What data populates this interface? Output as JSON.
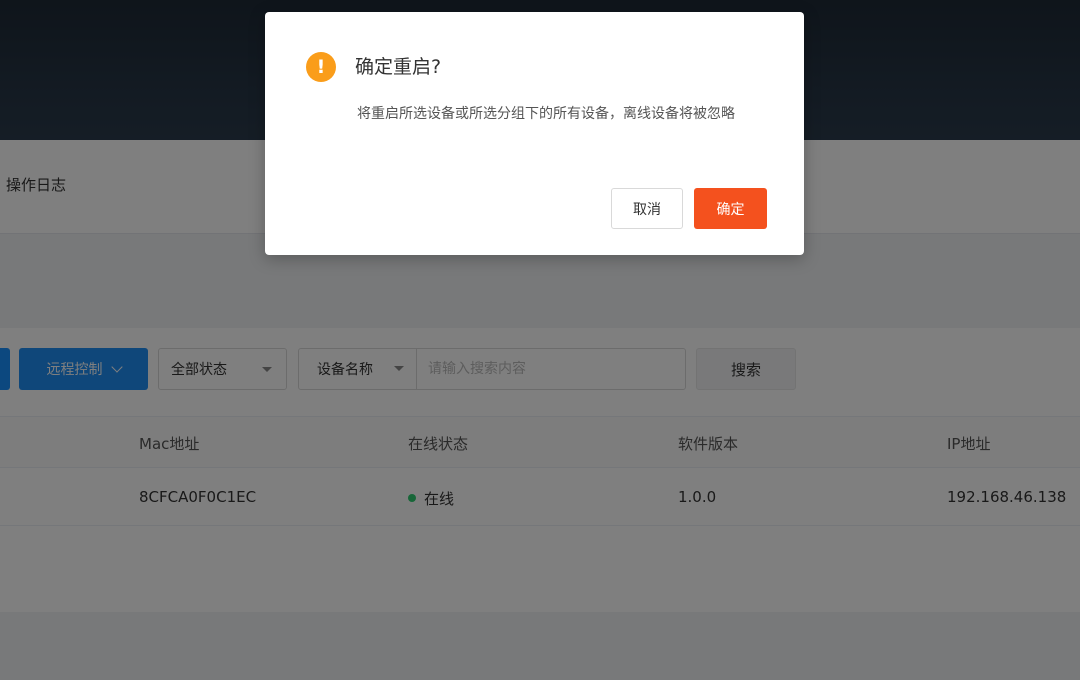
{
  "tabs": {
    "operation_log": "操作日志"
  },
  "toolbar": {
    "remote_control_label": "远程控制",
    "status_select_value": "全部状态",
    "field_select_value": "设备名称",
    "search_placeholder": "请输入搜索内容",
    "search_button_label": "搜索"
  },
  "table": {
    "columns": [
      "Mac地址",
      "在线状态",
      "软件版本",
      "IP地址"
    ],
    "rows": [
      {
        "mac": "8CFCA0F0C1EC",
        "status": "在线",
        "version": "1.0.0",
        "ip": "192.168.46.138"
      }
    ]
  },
  "dialog": {
    "icon": "warning-icon",
    "title": "确定重启?",
    "message": "将重启所选设备或所选分组下的所有设备，离线设备将被忽略",
    "cancel_label": "取消",
    "confirm_label": "确定"
  },
  "colors": {
    "primary": "#1f8ff5",
    "danger": "#f4511e",
    "warning": "#fa9d1a",
    "online": "#2ecc71",
    "topbar": "#263545"
  }
}
